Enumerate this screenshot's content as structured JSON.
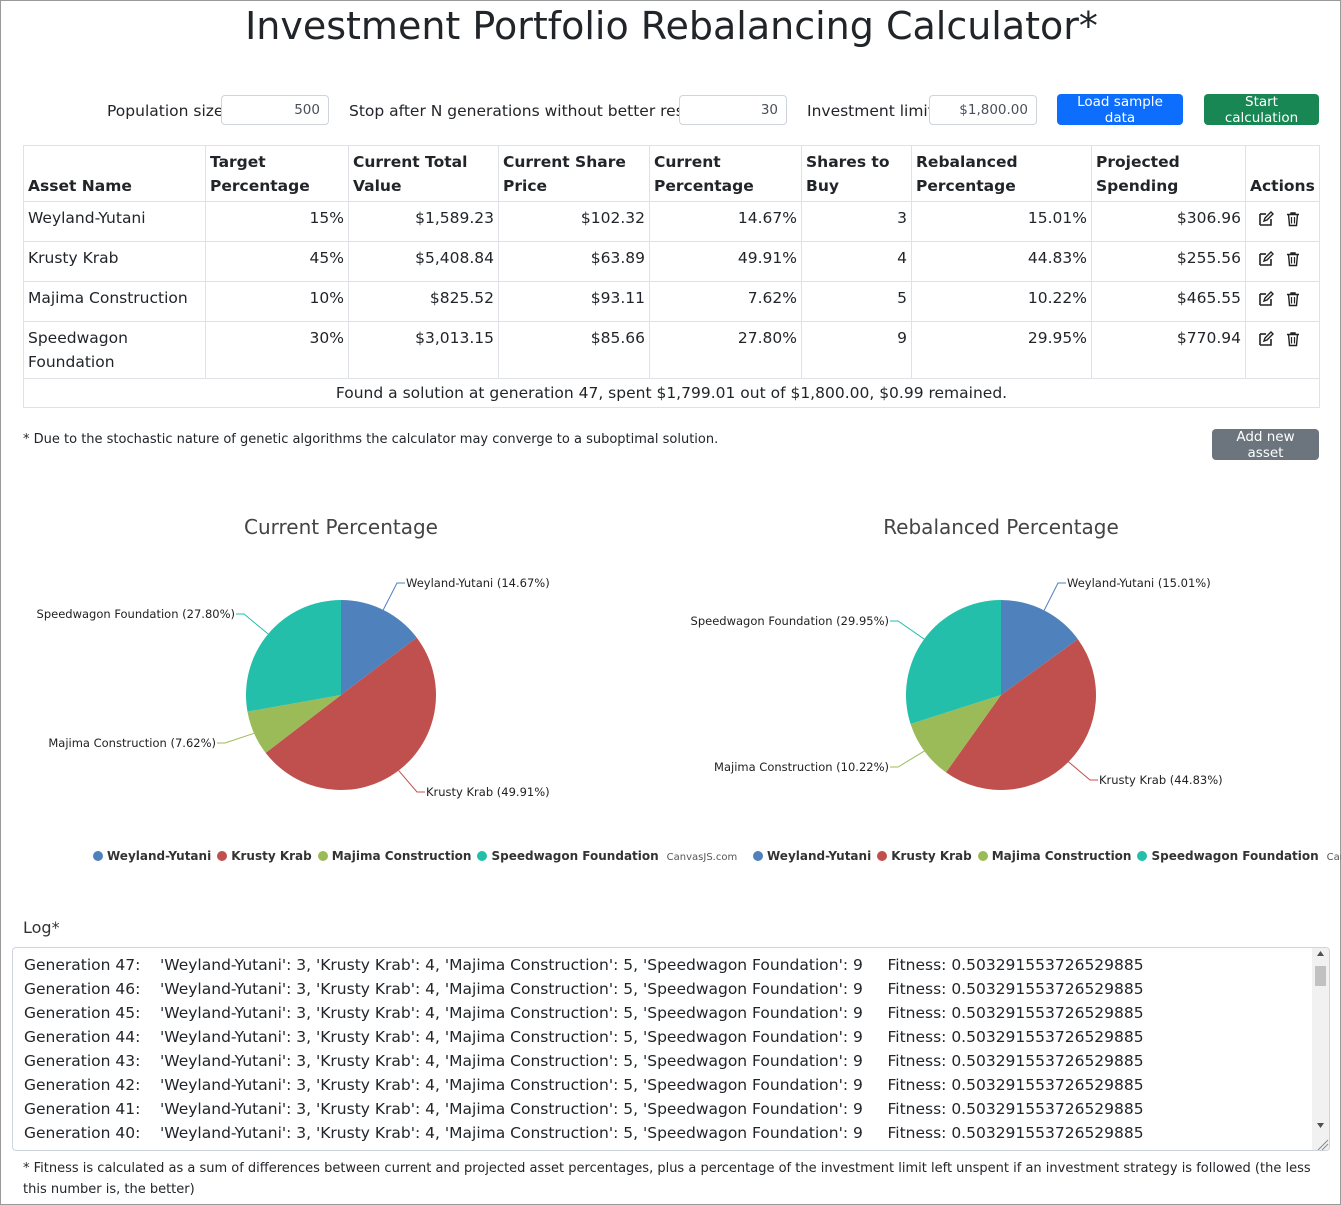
{
  "page": {
    "title": "Investment Portfolio Rebalancing Calculator*"
  },
  "params": {
    "population_label": "Population size:",
    "population_value": "500",
    "stop_label": "Stop after N generations without better result:",
    "stop_value": "30",
    "limit_label": "Investment limit:",
    "limit_value": "$1,800.00",
    "load_button": "Load sample data",
    "start_button": "Start calculation"
  },
  "table": {
    "headers": [
      "Asset Name",
      "Target Percentage",
      "Current Total Value",
      "Current Share Price",
      "Current Percentage",
      "Shares to Buy",
      "Rebalanced Percentage",
      "Projected Spending",
      "Actions"
    ],
    "rows": [
      [
        "Weyland-Yutani",
        "15%",
        "$1,589.23",
        "$102.32",
        "14.67%",
        "3",
        "15.01%",
        "$306.96"
      ],
      [
        "Krusty Krab",
        "45%",
        "$5,408.84",
        "$63.89",
        "49.91%",
        "4",
        "44.83%",
        "$255.56"
      ],
      [
        "Majima Construction",
        "10%",
        "$825.52",
        "$93.11",
        "7.62%",
        "5",
        "10.22%",
        "$465.55"
      ],
      [
        "Speedwagon Foundation",
        "30%",
        "$3,013.15",
        "$85.66",
        "27.80%",
        "9",
        "29.95%",
        "$770.94"
      ]
    ],
    "footer": "Found a solution at generation 47, spent $1,799.01 out of $1,800.00, $0.99 remained."
  },
  "note": "* Due to the stochastic nature of genetic algorithms the calculator may converge to a suboptimal solution.",
  "add_button": "Add new asset",
  "colors": {
    "Weyland-Yutani": "#4f81bc",
    "Krusty Krab": "#c0504e",
    "Majima Construction": "#9bbb58",
    "Speedwagon Foundation": "#23bfaa"
  },
  "credit": "CanvasJS.com",
  "chart_data": [
    {
      "type": "pie",
      "title": "Current Percentage",
      "categories": [
        "Weyland-Yutani",
        "Krusty Krab",
        "Majima Construction",
        "Speedwagon Foundation"
      ],
      "values": [
        14.67,
        49.91,
        7.62,
        27.8
      ],
      "labels": [
        "Weyland-Yutani (14.67%)",
        "Krusty Krab (49.91%)",
        "Majima Construction (7.62%)",
        "Speedwagon Foundation (27.80%)"
      ],
      "legend": "bottom"
    },
    {
      "type": "pie",
      "title": "Rebalanced Percentage",
      "categories": [
        "Weyland-Yutani",
        "Krusty Krab",
        "Majima Construction",
        "Speedwagon Foundation"
      ],
      "values": [
        15.01,
        44.83,
        10.22,
        29.95
      ],
      "labels": [
        "Weyland-Yutani (15.01%)",
        "Krusty Krab (44.83%)",
        "Majima Construction (10.22%)",
        "Speedwagon Foundation (29.95%)"
      ],
      "legend": "bottom"
    }
  ],
  "log": {
    "title": "Log*",
    "lines": [
      "Generation 47:    'Weyland-Yutani': 3, 'Krusty Krab': 4, 'Majima Construction': 5, 'Speedwagon Foundation': 9     Fitness: 0.503291553726529885",
      "Generation 46:    'Weyland-Yutani': 3, 'Krusty Krab': 4, 'Majima Construction': 5, 'Speedwagon Foundation': 9     Fitness: 0.503291553726529885",
      "Generation 45:    'Weyland-Yutani': 3, 'Krusty Krab': 4, 'Majima Construction': 5, 'Speedwagon Foundation': 9     Fitness: 0.503291553726529885",
      "Generation 44:    'Weyland-Yutani': 3, 'Krusty Krab': 4, 'Majima Construction': 5, 'Speedwagon Foundation': 9     Fitness: 0.503291553726529885",
      "Generation 43:    'Weyland-Yutani': 3, 'Krusty Krab': 4, 'Majima Construction': 5, 'Speedwagon Foundation': 9     Fitness: 0.503291553726529885",
      "Generation 42:    'Weyland-Yutani': 3, 'Krusty Krab': 4, 'Majima Construction': 5, 'Speedwagon Foundation': 9     Fitness: 0.503291553726529885",
      "Generation 41:    'Weyland-Yutani': 3, 'Krusty Krab': 4, 'Majima Construction': 5, 'Speedwagon Foundation': 9     Fitness: 0.503291553726529885",
      "Generation 40:    'Weyland-Yutani': 3, 'Krusty Krab': 4, 'Majima Construction': 5, 'Speedwagon Foundation': 9     Fitness: 0.503291553726529885"
    ]
  },
  "fine_print": "* Fitness is calculated as a sum of differences between current and projected asset percentages, plus a percentage of the investment limit left unspent if an investment strategy is followed (the less this number is, the better)"
}
